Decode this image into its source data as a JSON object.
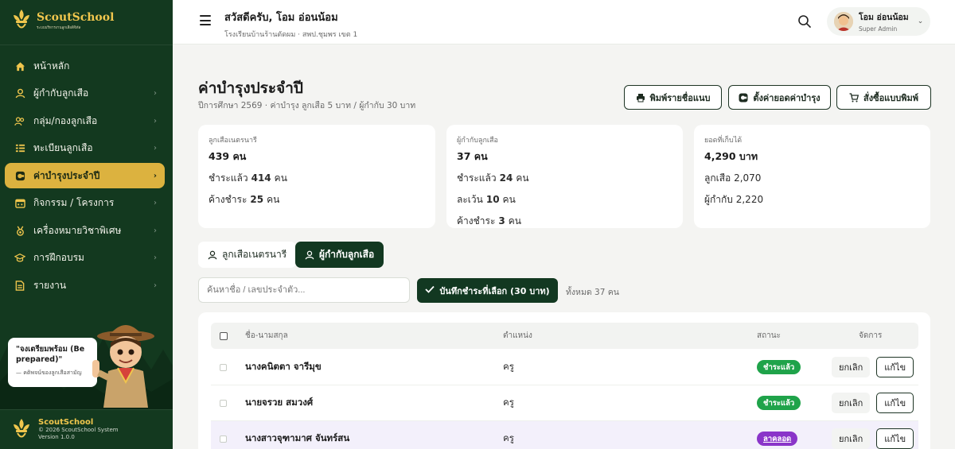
{
  "brand": {
    "name": "ScoutSchool",
    "tagline": "ระบบบริหารงานลูกเสือดิจิทัล"
  },
  "sidebar": {
    "items": [
      {
        "label": "หน้าหลัก",
        "icon": "home-icon",
        "chevron": false,
        "active": false
      },
      {
        "label": "ผู้กำกับลูกเสือ",
        "icon": "user-icon",
        "chevron": true,
        "active": false
      },
      {
        "label": "กลุ่ม/กองลูกเสือ",
        "icon": "users-icon",
        "chevron": true,
        "active": false
      },
      {
        "label": "ทะเบียนลูกเสือ",
        "icon": "list-icon",
        "chevron": true,
        "active": false
      },
      {
        "label": "ค่าบำรุงประจำปี",
        "icon": "coins-icon",
        "chevron": true,
        "active": true
      },
      {
        "label": "กิจกรรม / โครงการ",
        "icon": "calendar-icon",
        "chevron": true,
        "active": false
      },
      {
        "label": "เครื่องหมายวิชาพิเศษ",
        "icon": "medal-icon",
        "chevron": true,
        "active": false
      },
      {
        "label": "การฝึกอบรม",
        "icon": "graduation-cap-icon",
        "chevron": true,
        "active": false
      },
      {
        "label": "รายงาน",
        "icon": "report-icon",
        "chevron": true,
        "active": false
      }
    ],
    "quote": "\"จงเตรียมพร้อม (Be prepared)\"",
    "quote_source": "— คติพจน์ของลูกเสือสามัญ",
    "footer": {
      "name": "ScoutSchool",
      "copyright": "© 2026 ScoutSchool System",
      "version": "Version 1.0.0"
    }
  },
  "header": {
    "greeting": "สวัสดีครับ, โอม อ่อนน้อม",
    "school": "โรงเรียนบ้านร้านตัดผม · สพป.ชุมพร เขต 1",
    "user": {
      "name": "โอม อ่อนน้อม",
      "role": "Super Admin"
    }
  },
  "main": {
    "title": "ค่าบำรุงประจำปี",
    "subtitle": "ปีการศึกษา 2569 · ค่าบำรุง ลูกเสือ 5 บาท / ผู้กำกับ 30 บาท",
    "actions": {
      "print_list": "พิมพ์รายชื่อแนบ",
      "set_fee": "ตั้งค่ายอดค่าบำรุง",
      "order_form": "สั่งซื้อแบบพิมพ์"
    },
    "cards": [
      {
        "label": "ลูกเสือเนตรนารี",
        "main": "439 คน",
        "lines": [
          {
            "pre": "ชำระแล้ว",
            "val": "414",
            "post": "คน"
          },
          {
            "pre": "ค้างชำระ",
            "val": "25",
            "post": "คน"
          }
        ]
      },
      {
        "label": "ผู้กำกับลูกเสือ",
        "main": "37 คน",
        "lines": [
          {
            "pre": "ชำระแล้ว",
            "val": "24",
            "post": "คน"
          },
          {
            "pre": "ละเว้น",
            "val": "10",
            "post": "คน"
          },
          {
            "pre": "ค้างชำระ",
            "val": "3",
            "post": "คน"
          }
        ]
      },
      {
        "label": "ยอดที่เก็บได้",
        "main": "4,290 บาท",
        "lines": [
          {
            "text": "ลูกเสือ 2,070"
          },
          {
            "text": "ผู้กำกับ 2,220"
          }
        ]
      }
    ],
    "tabs": [
      {
        "label": "ลูกเสือเนตรนารี",
        "active": false
      },
      {
        "label": "ผู้กำกับลูกเสือ",
        "active": true
      }
    ],
    "search_placeholder": "ค้นหาชื่อ / เลขประจำตัว...",
    "record_button": "บันทึกชำระที่เลือก (30 บาท)",
    "total": "ทั้งหมด 37 คน",
    "table": {
      "headers": {
        "name": "ชื่อ-นามสกุล",
        "position": "ตำแหน่ง",
        "status": "สถานะ",
        "action": "จัดการ"
      },
      "rows": [
        {
          "name": "นางคนิตตา จารีมุข",
          "position": "ครู",
          "status": "ชำระแล้ว",
          "cancel": "ยกเลิก",
          "edit": "แก้ไข"
        },
        {
          "name": "นายจรวย สมวงศ์",
          "position": "ครู",
          "status": "ชำระแล้ว",
          "cancel": "ยกเลิก",
          "edit": "แก้ไข"
        },
        {
          "name": "นางสาวจุฑามาศ จันทร์สน",
          "position": "ครู",
          "status": "ลาคลอด",
          "cancel": "ยกเลิก",
          "edit": "แก้ไข"
        }
      ]
    }
  },
  "colors": {
    "sidebar_bg": "#13391f",
    "accent_gold": "#dcb23f",
    "primary_dark": "#123821",
    "paid": "#1fa34a",
    "leave": "#8a35c9"
  }
}
